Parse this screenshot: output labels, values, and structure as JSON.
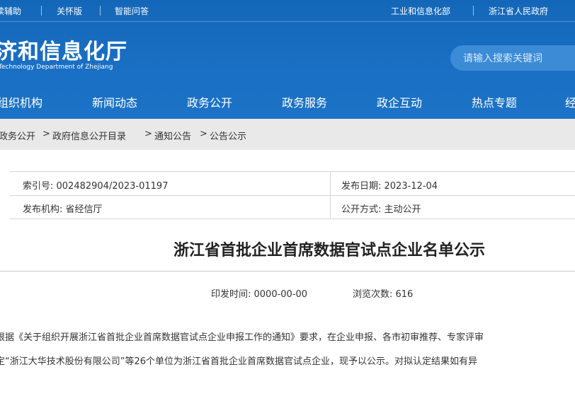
{
  "topbar": {
    "accessibility": "读辅助",
    "care_mode": "关怀版",
    "qa": "智能问答",
    "miit": "工业和信息化部",
    "zj_gov": "浙江省人民政府"
  },
  "site": {
    "name_cn": "济和信息化厅",
    "name_en": "Technology Department of Zhejiang"
  },
  "search": {
    "placeholder": "请输入搜索关键词"
  },
  "nav": [
    "组织机构",
    "新闻动态",
    "政务公开",
    "政务服务",
    "政企互动",
    "热点专题",
    "经"
  ],
  "breadcrumb": [
    "政务公开",
    "政府信息公开目录",
    "通知公告",
    "公告公示"
  ],
  "breadcrumb_sep": ">",
  "info": {
    "index_no": "索引号: 002482904/2023-01197",
    "publish_date": "发布日期: 2023-12-04",
    "publisher": "发布机构: 省经信厅",
    "disclosure": "公开方式: 主动公开"
  },
  "article": {
    "title": "浙江省首批企业首席数据官试点企业名单公示",
    "print_time": "印发时间: 0000-00-00",
    "views": "浏览次数: 616",
    "para_line1": "根据《关于组织开展浙江省首批企业首席数据官试点企业申报工作的通知》要求，在企业申报、各市初审推荐、专家评审",
    "para_line2": "定“浙江大华技术股份有限公司”等26个单位为浙江省首批企业首席数据官试点企业，现予以公示。对拟认定结果如有异"
  },
  "colors": {
    "header_blue": "#1a6fc3",
    "crumb_bg": "#e9e9e9"
  }
}
